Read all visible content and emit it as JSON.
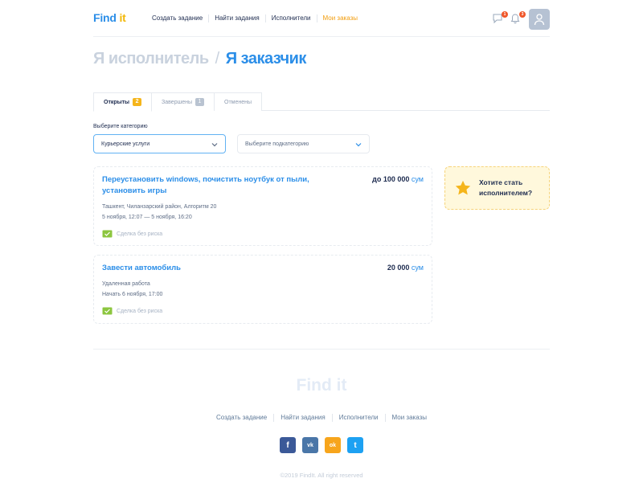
{
  "header": {
    "logo_part1": "Find",
    "logo_part2": "it",
    "nav": [
      "Создать задание",
      "Найти задания",
      "Исполнители",
      "Мои заказы"
    ],
    "messages_count": "1",
    "notifications_count": "3",
    "icons": [
      "message-icon",
      "bell-icon",
      "user-icon"
    ]
  },
  "page_title": {
    "inactive": "Я исполнитель",
    "separator": "/",
    "active": "Я заказчик"
  },
  "tabs": [
    {
      "label": "Открыты",
      "count": "2"
    },
    {
      "label": "Завершены",
      "count": "1"
    },
    {
      "label": "Отменены"
    }
  ],
  "filters": {
    "category_label": "Выберите категорию",
    "category_value": "Курьерские услуги",
    "subcategory_value": "Выберите подкатегорию"
  },
  "orders": [
    {
      "title": "Переустановить windows, почистить ноутбук от пыли, установить игры",
      "price": "до 100 000",
      "currency": "сум",
      "location": "Ташкент, Чиланзарский район, Алгоритм 20",
      "dates": "5 ноября, 12:07 — 5 ноября, 16:20",
      "safe_deal": "Сделка без риска"
    },
    {
      "title": "Завести автомобиль",
      "price": "20 000",
      "currency": "сум",
      "location": "Удаленная работа",
      "dates": "Начать 6 ноября, 17:00",
      "safe_deal": "Сделка без риска"
    }
  ],
  "promo": {
    "text": "Хотите стать исполнителем?",
    "icon": "star-icon"
  },
  "footer": {
    "logo": "Find it",
    "nav": [
      "Создать задание",
      "Найти задания",
      "Исполнители",
      "Мои заказы"
    ],
    "social": [
      {
        "name": "facebook",
        "glyph": "f",
        "color": "#3b5998"
      },
      {
        "name": "vk",
        "glyph": "vk",
        "color": "#4a76a8"
      },
      {
        "name": "odnoklassniki",
        "glyph": "ok",
        "color": "#f7a51c"
      },
      {
        "name": "twitter",
        "glyph": "t",
        "color": "#1da1f2"
      }
    ],
    "copyright": "©2019 FindIt. All right reserved"
  },
  "colors": {
    "brand_blue": "#2b8ee8",
    "brand_yellow": "#f2b705",
    "accent_orange": "#f29d0d",
    "text_dark": "#1d2b4f"
  }
}
